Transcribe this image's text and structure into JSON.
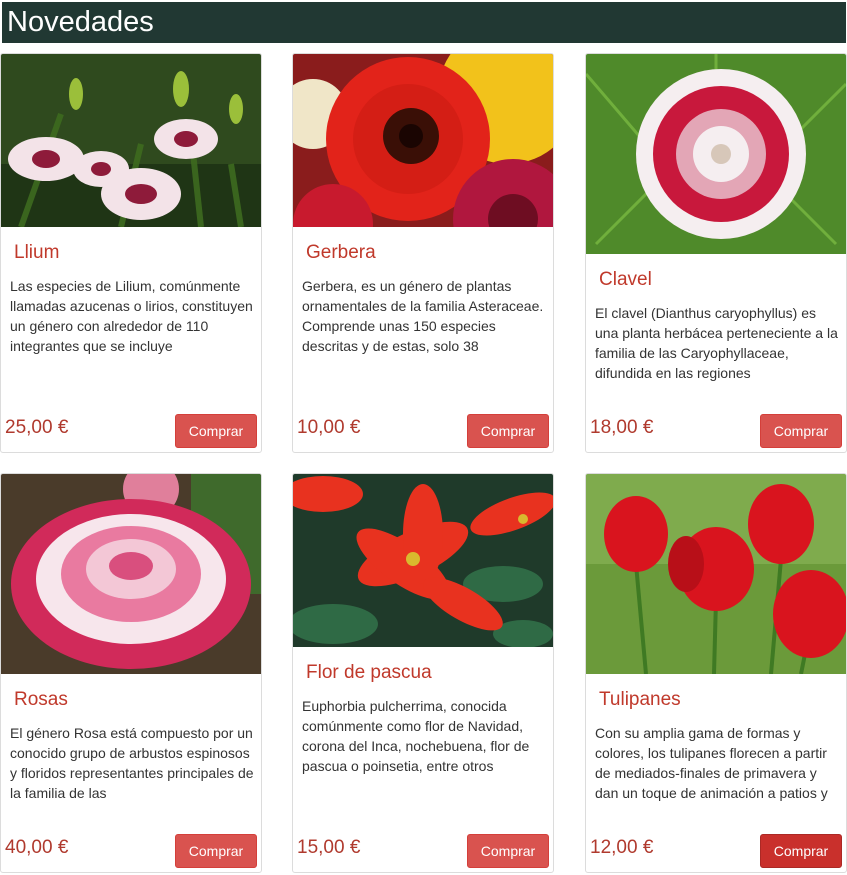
{
  "header": {
    "title": "Novedades"
  },
  "products": [
    {
      "name": "Llium",
      "description": "Las especies de Lilium, comúnmente llamadas azucenas o lirios, constituyen un género con alrededor de 110 integrantes que se incluye",
      "price": "25,00 €",
      "button": "Comprar",
      "image": "lilium-flower-photo"
    },
    {
      "name": "Gerbera",
      "description": "Gerbera, es un género de plantas ornamentales de la familia Asteraceae. Comprende unas 150 especies descritas y de estas, solo 38",
      "price": "10,00 €",
      "button": "Comprar",
      "image": "gerbera-flower-photo"
    },
    {
      "name": "Clavel",
      "description": "El clavel (Dianthus caryophyllus) es una planta herbácea perteneciente a la familia de las Caryophyllaceae, difundida en las regiones",
      "price": "18,00 €",
      "button": "Comprar",
      "image": "carnation-flower-photo"
    },
    {
      "name": "Rosas",
      "description": "El género Rosa está compuesto por un conocido grupo de arbustos espinosos y floridos representantes principales de la familia de las",
      "price": "40,00 €",
      "button": "Comprar",
      "image": "rose-flower-photo"
    },
    {
      "name": "Flor de pascua",
      "description": "Euphorbia pulcherrima, conocida comúnmente como flor de Navidad, corona del Inca, nochebuena, flor de pascua o poinsetia, entre otros",
      "price": "15,00 €",
      "button": "Comprar",
      "image": "poinsettia-flower-photo"
    },
    {
      "name": "Tulipanes",
      "description": "Con su amplia gama de formas y colores, los tulipanes florecen a partir de mediados-finales de primavera y dan un toque de animación a patios y",
      "price": "12,00 €",
      "button": "Comprar",
      "image": "tulip-flower-photo"
    }
  ],
  "colors": {
    "header_bg": "#213833",
    "accent_red": "#c0392b",
    "button_bg": "#d9534f"
  }
}
